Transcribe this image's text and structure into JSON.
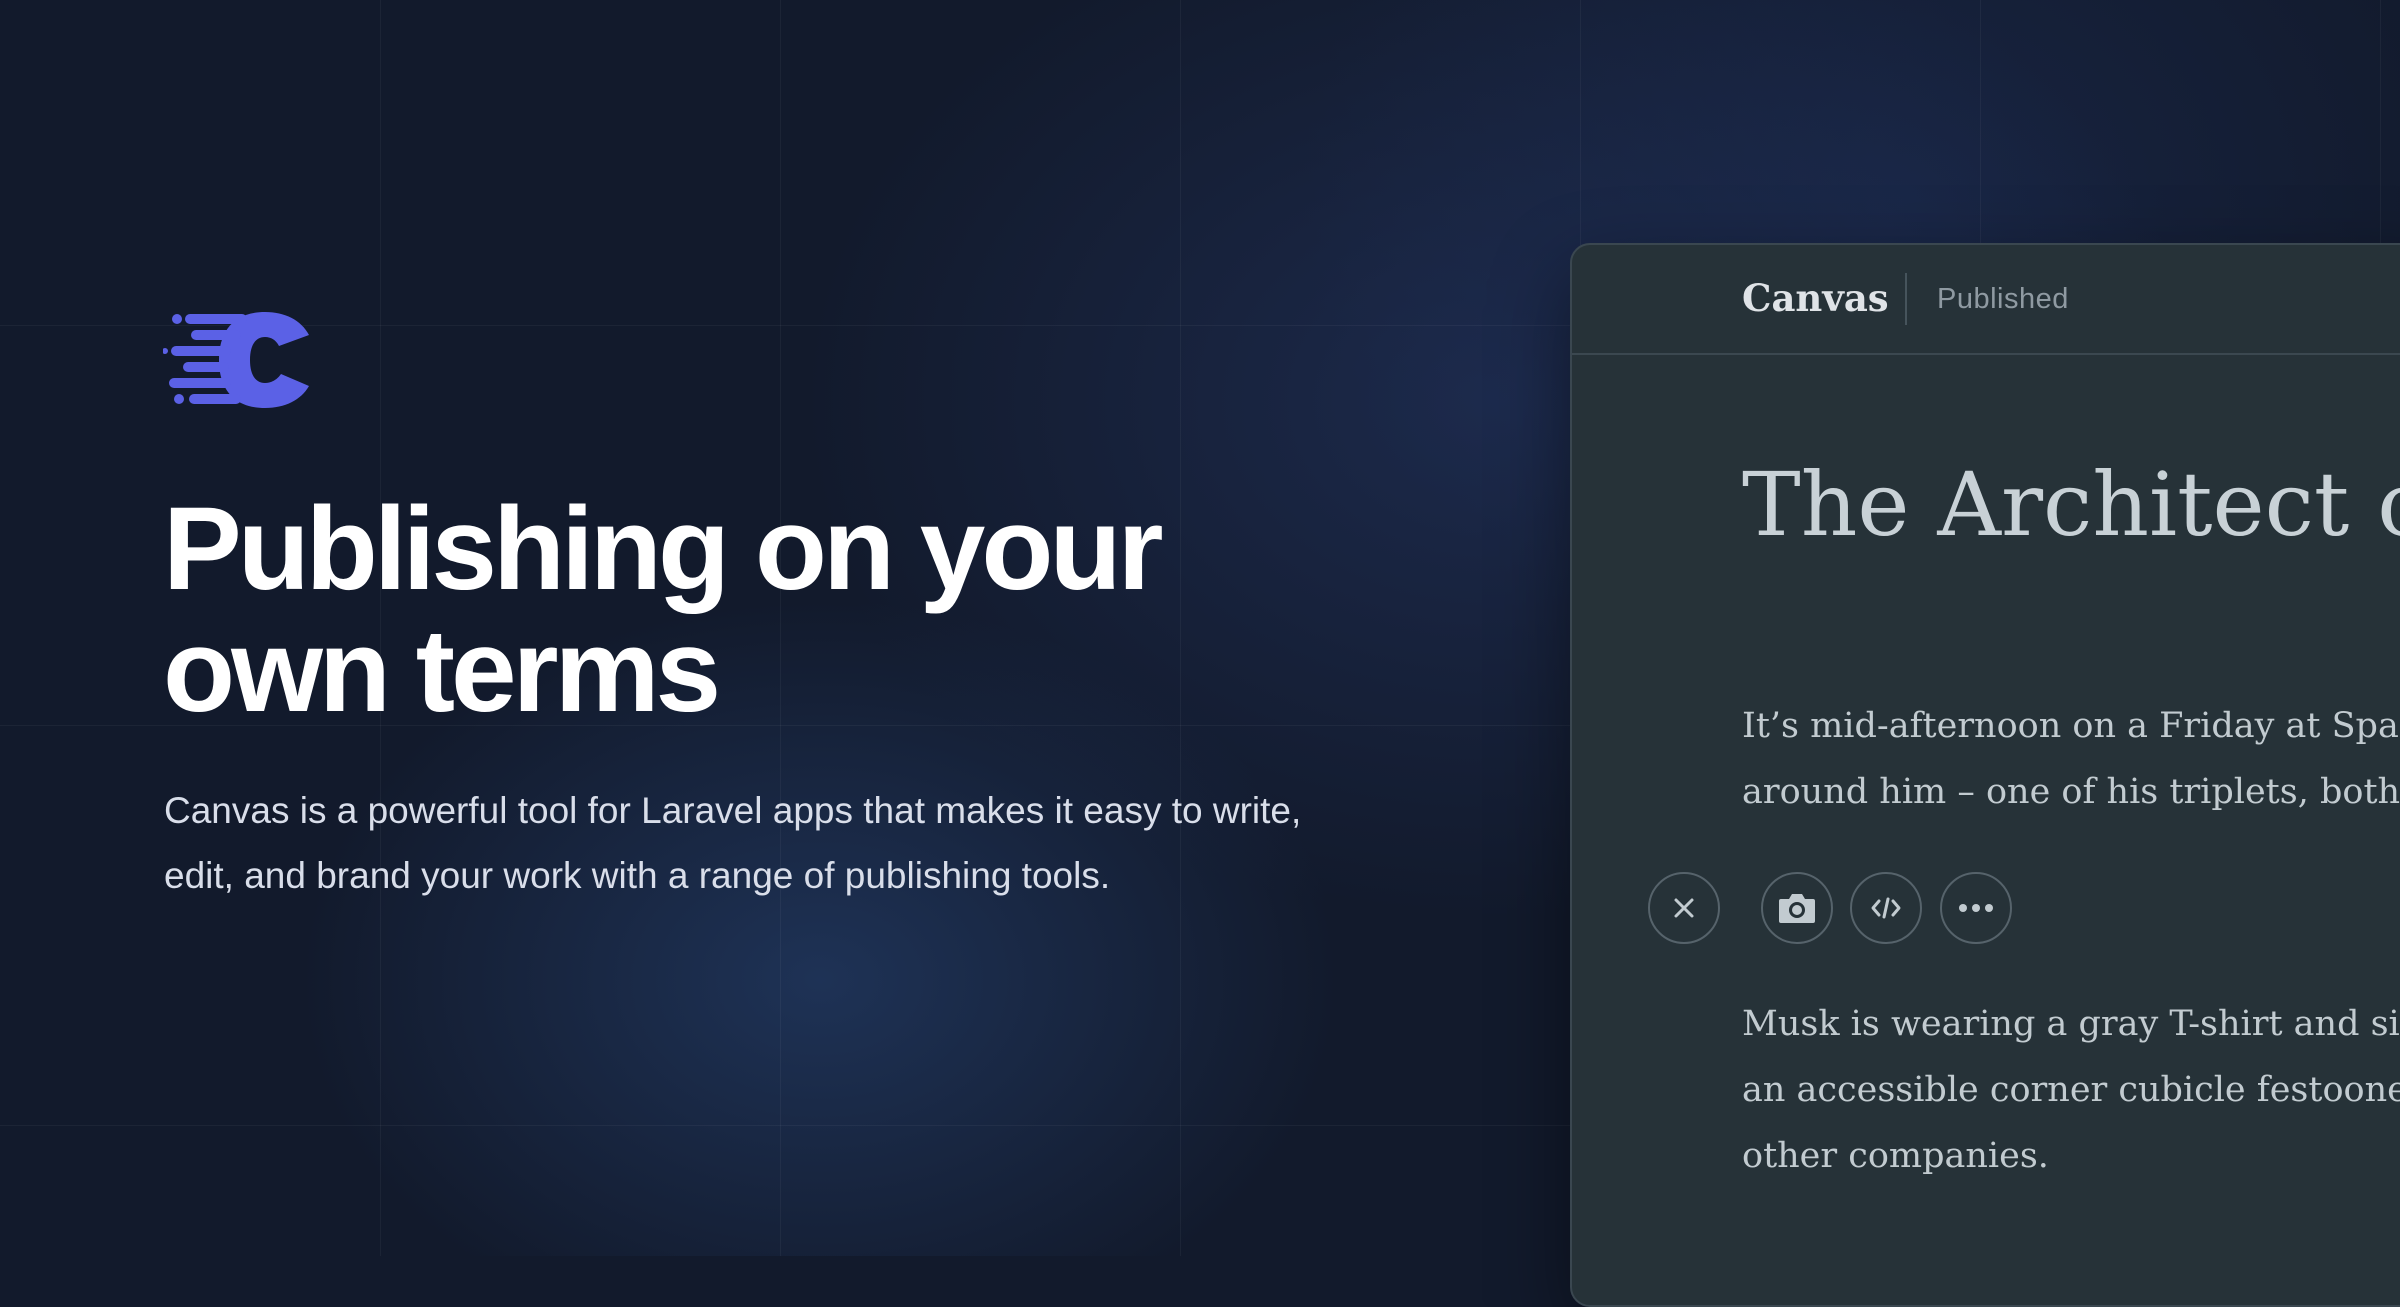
{
  "hero": {
    "headline_line1": "Publishing on your",
    "headline_line2": "own terms",
    "subtitle_line1": "Canvas is a powerful tool for Laravel apps that makes it easy to write,",
    "subtitle_line2": "edit, and brand your work with a range of publishing tools."
  },
  "logo": {
    "icon": "canvas-logo-icon",
    "color": "#5b61e6"
  },
  "editor": {
    "brand": "Canvas",
    "status": "Published",
    "article_title": "The Architect of T",
    "paragraph1": [
      "It’s mid-afternoon on a Friday at SpaceX",
      "around him – one of his triplets, both of"
    ],
    "toolbar": {
      "close_icon": "close-icon",
      "image_icon": "camera-icon",
      "embed_icon": "code-icon",
      "more_icon": "more-icon"
    },
    "paragraph2": [
      "Musk is wearing a gray T-shirt and sittin",
      "an accessible corner cubicle festooned wi",
      "other companies."
    ]
  },
  "colors": {
    "background": "#121a2c",
    "panel": "#263238",
    "accent": "#5b61e6"
  }
}
